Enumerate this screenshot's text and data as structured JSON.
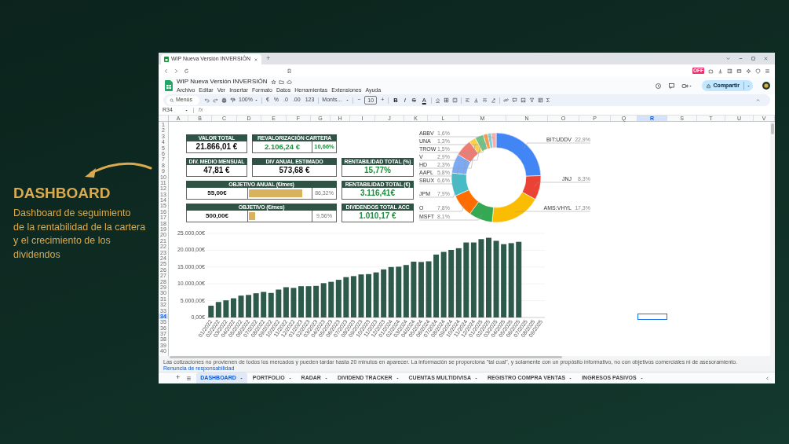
{
  "slide": {
    "heading": "DASHBOARD",
    "description": [
      "Dashboard de seguimiento",
      "de la rentabilidad de la cartera",
      "y el crecimiento de los",
      "dividendos"
    ]
  },
  "browser": {
    "tab_title": "WIP Nueva Versión INVERSIÓN",
    "new_tab": "+",
    "extension_badge": "OFF"
  },
  "document": {
    "title": "WIP Nueva Versión INVERSIÓN",
    "menus": [
      "Archivo",
      "Editar",
      "Ver",
      "Insertar",
      "Formato",
      "Datos",
      "Herramientas",
      "Extensiones",
      "Ayuda"
    ],
    "share_button": "Compartir"
  },
  "toolbar": {
    "menus_search": "Menús",
    "zoom": "100%",
    "format_buttons": [
      "€",
      "%",
      ".0",
      ".00",
      "123"
    ],
    "font": "Monts...",
    "size_minus": "−",
    "font_size": "10",
    "size_plus": "+",
    "style_buttons": [
      "B",
      "I",
      "S",
      "A"
    ],
    "function_button": "Σ"
  },
  "formula_bar": {
    "cell_reference": "R34",
    "function_label": "fx"
  },
  "column_headers": [
    {
      "label": "A",
      "selected": false
    },
    {
      "label": "B",
      "selected": false
    },
    {
      "label": "C",
      "selected": false
    },
    {
      "label": "D",
      "selected": false
    },
    {
      "label": "E",
      "selected": false
    },
    {
      "label": "F",
      "selected": false
    },
    {
      "label": "G",
      "selected": false
    },
    {
      "label": "H",
      "selected": false
    },
    {
      "label": "I",
      "selected": false
    },
    {
      "label": "J",
      "selected": false
    },
    {
      "label": "K",
      "selected": false
    },
    {
      "label": "L",
      "selected": false
    },
    {
      "label": "M",
      "selected": false
    },
    {
      "label": "N",
      "selected": false
    },
    {
      "label": "O",
      "selected": false
    },
    {
      "label": "P",
      "selected": false
    },
    {
      "label": "Q",
      "selected": false
    },
    {
      "label": "R",
      "selected": true
    },
    {
      "label": "S",
      "selected": false
    },
    {
      "label": "T",
      "selected": false
    },
    {
      "label": "U",
      "selected": false
    },
    {
      "label": "V",
      "selected": false
    }
  ],
  "row_numbers": [
    {
      "label": "1",
      "selected": false
    },
    {
      "label": "2",
      "selected": false
    },
    {
      "label": "3",
      "selected": false
    },
    {
      "label": "4",
      "selected": false
    },
    {
      "label": "5",
      "selected": false
    },
    {
      "label": "6",
      "selected": false
    },
    {
      "label": "7",
      "selected": false
    },
    {
      "label": "8",
      "selected": false
    },
    {
      "label": "9",
      "selected": false
    },
    {
      "label": "10",
      "selected": false
    },
    {
      "label": "11",
      "selected": false
    },
    {
      "label": "12",
      "selected": false
    },
    {
      "label": "13",
      "selected": false
    },
    {
      "label": "14",
      "selected": false
    },
    {
      "label": "15",
      "selected": false
    },
    {
      "label": "16",
      "selected": false
    },
    {
      "label": "17",
      "selected": false
    },
    {
      "label": "18",
      "selected": false
    },
    {
      "label": "19",
      "selected": false
    },
    {
      "label": "20",
      "selected": false
    },
    {
      "label": "21",
      "selected": false
    },
    {
      "label": "22",
      "selected": false
    },
    {
      "label": "23",
      "selected": false
    },
    {
      "label": "24",
      "selected": false
    },
    {
      "label": "25",
      "selected": false
    },
    {
      "label": "26",
      "selected": false
    },
    {
      "label": "27",
      "selected": false
    },
    {
      "label": "28",
      "selected": false
    },
    {
      "label": "29",
      "selected": false
    },
    {
      "label": "30",
      "selected": false
    },
    {
      "label": "31",
      "selected": false
    },
    {
      "label": "32",
      "selected": false
    },
    {
      "label": "33",
      "selected": false
    },
    {
      "label": "34",
      "selected": true
    },
    {
      "label": "35",
      "selected": false
    },
    {
      "label": "36",
      "selected": false
    },
    {
      "label": "37",
      "selected": false
    },
    {
      "label": "38",
      "selected": false
    },
    {
      "label": "39",
      "selected": false
    },
    {
      "label": "40",
      "selected": false
    }
  ],
  "kpis": [
    {
      "kind": "single",
      "header": "VALOR TOTAL",
      "value": "21.866,01 €",
      "positive": false
    },
    {
      "kind": "split",
      "header": "REVALORIZACIÓN CARTERA",
      "value": "2.106,24 €",
      "percent": "10,66%",
      "positive": true
    },
    {
      "kind": "single",
      "header": "DIV. MEDIO MENSUAL",
      "value": "47,81 €",
      "positive": false
    },
    {
      "kind": "single",
      "header": "DIV ANUAL ESTIMADO",
      "value": "573,68 €",
      "positive": false
    },
    {
      "kind": "single",
      "header": "RENTABILIDAD TOTAL (%)",
      "value": "15,77%",
      "positive": true
    },
    {
      "kind": "goal",
      "header": "OBJETIVO ANUAL (€/mes)",
      "value": "55,00€",
      "level": 0.8632,
      "percent": "86,32%",
      "positive": false
    },
    {
      "kind": "single",
      "header": "RENTABILIDAD TOTAL (€)",
      "value": "3.116,41€",
      "positive": true
    },
    {
      "kind": "goal",
      "header": "OBJETIVO (€/mes)",
      "value": "500,00€",
      "level": 0.0956,
      "percent": "9,56%",
      "positive": false
    },
    {
      "kind": "single",
      "header": "DIVIDENDOS TOTAL ACC",
      "value": "1.010,17 €",
      "positive": true
    }
  ],
  "donut_chart": {
    "chart_data": {
      "type": "donut",
      "categories": [
        "BIT:UDDV",
        "JNJ",
        "AMS:VHYL",
        "MSFT",
        "O",
        "JPM",
        "SBUX",
        "AAPL",
        "HD",
        "V",
        "TROW",
        "UNA",
        "ABBV"
      ],
      "values": [
        22.9,
        8.3,
        17.3,
        8.1,
        7.8,
        7.9,
        6.6,
        5.8,
        2.3,
        2.9,
        1.5,
        1.3,
        1.6
      ],
      "value_labels": [
        "22,9%",
        "8,3%",
        "17,3%",
        "8,1%",
        "7,8%",
        "7,9%",
        "6,6%",
        "5,8%",
        "2,3%",
        "2,9%",
        "1,5%",
        "1,3%",
        "1,6%"
      ],
      "colors": [
        "#4285f4",
        "#ea4335",
        "#fbbc04",
        "#34a853",
        "#ff6d01",
        "#46bdc6",
        "#7baaf7",
        "#f07b72",
        "#fcd04f",
        "#71c287",
        "#ff994d",
        "#7ed1d7",
        "#f6aea9"
      ]
    }
  },
  "bar_chart": {
    "chart_data": {
      "type": "bar",
      "categories": [
        "01/2022",
        "02/2022",
        "03/2022",
        "04/2022",
        "05/2022",
        "06/2022",
        "07/2022",
        "08/2022",
        "09/2022",
        "10/2022",
        "11/2022",
        "12/2022",
        "01/2023",
        "02/2023",
        "03/2023",
        "04/2023",
        "05/2023",
        "06/2023",
        "07/2023",
        "08/2023",
        "09/2023",
        "10/2023",
        "11/2023",
        "12/2023",
        "01/2024",
        "02/2024",
        "03/2024",
        "04/2024",
        "05/2024",
        "06/2024",
        "07/2024",
        "08/2024",
        "09/2024",
        "10/2024",
        "11/2024",
        "12/2024",
        "01/2025",
        "02/2025",
        "03/2025",
        "04/2025",
        "05/2025",
        "06/2025",
        "07/2025",
        "08/2025",
        "09/2025"
      ],
      "values": [
        3500,
        4600,
        5100,
        5700,
        6500,
        6700,
        7200,
        7600,
        7300,
        8300,
        9000,
        8800,
        9300,
        9300,
        9400,
        10200,
        10600,
        11200,
        12000,
        12300,
        12800,
        12900,
        13400,
        14300,
        15000,
        15100,
        15600,
        16600,
        16500,
        16700,
        18700,
        19500,
        20100,
        20600,
        22300,
        22300,
        23300,
        23700,
        22800,
        21800,
        22100,
        22500,
        null,
        null,
        null
      ],
      "ylim": [
        0,
        25000
      ],
      "grid": true,
      "yticks": [
        {
          "value": 0,
          "label": "0,00€"
        },
        {
          "value": 5000,
          "label": "5.000,00€"
        },
        {
          "value": 10000,
          "label": "10.000,00€"
        },
        {
          "value": 15000,
          "label": "15.000,00€"
        },
        {
          "value": 20000,
          "label": "20.000,00€"
        },
        {
          "value": 25000,
          "label": "25.000,00€"
        }
      ]
    }
  },
  "disclaimer": {
    "text": "Las cotizaciones no provienen de todos los mercados y pueden tardar hasta 20 minutos en aparecer. La información se proporciona \"tal cual\", y solamente con un propósito informativo, no con objetivos comerciales ni de asesoramiento.",
    "link": "Renuncia de responsabilidad"
  },
  "sheet_tabs": {
    "add": "+",
    "items": [
      {
        "label": "DASHBOARD",
        "selected": true
      },
      {
        "label": "PORTFOLIO",
        "selected": false
      },
      {
        "label": "RADAR",
        "selected": false
      },
      {
        "label": "DIVIDEND TRACKER",
        "selected": false
      },
      {
        "label": "CUENTAS MULTIDIVISA",
        "selected": false
      },
      {
        "label": "REGISTRO COMPRA VENTAS",
        "selected": false
      },
      {
        "label": "INGRESOS PASIVOS",
        "selected": false
      }
    ]
  }
}
